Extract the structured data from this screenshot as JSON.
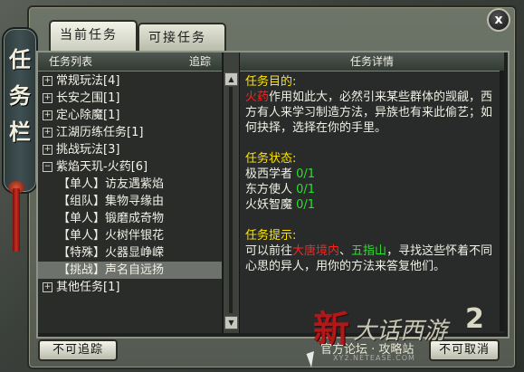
{
  "window": {
    "title_glyphs": [
      "任",
      "务",
      "栏"
    ],
    "close_label": "x"
  },
  "tabs": [
    {
      "label": "当前任务",
      "active": true
    },
    {
      "label": "可接任务",
      "active": false
    }
  ],
  "list_panel": {
    "header": "任务列表",
    "track_header": "追踪",
    "categories": [
      {
        "toggle": "+",
        "label": "常规玩法[4]"
      },
      {
        "toggle": "+",
        "label": "长安之围[1]"
      },
      {
        "toggle": "+",
        "label": "定心除魔[1]"
      },
      {
        "toggle": "+",
        "label": "江湖历练任务[1]"
      },
      {
        "toggle": "+",
        "label": "挑战玩法[3]"
      },
      {
        "toggle": "−",
        "label": "紫焰天玑-火药[6]"
      }
    ],
    "subtasks": [
      {
        "tag": "【单人】",
        "name": "访友遇紫焰",
        "selected": false
      },
      {
        "tag": "【组队】",
        "name": "集物寻缘由",
        "selected": false
      },
      {
        "tag": "【单人】",
        "name": "锻磨成奇物",
        "selected": false
      },
      {
        "tag": "【单人】",
        "name": "火树伴银花",
        "selected": false
      },
      {
        "tag": "【特殊】",
        "name": "火器显峥嵘",
        "selected": false
      },
      {
        "tag": "【挑战】",
        "name": "声名自远扬",
        "selected": true
      }
    ],
    "last_category": {
      "toggle": "+",
      "label": "其他任务[1]"
    }
  },
  "detail_panel": {
    "header": "任务详情",
    "goal_title": "任务目的:",
    "goal_highlight": "火药",
    "goal_text": "作用如此大，必然引来某些群体的觊觎，西方有人来学习制造方法，异族也有来此偷艺；如何抉择，选择在你的手里。",
    "status_title": "任务状态:",
    "status_items": [
      {
        "label": "极西学者",
        "progress": "0/1"
      },
      {
        "label": "东方使人",
        "progress": "0/1"
      },
      {
        "label": "火妖智魔",
        "progress": "0/1"
      }
    ],
    "hint_title": "任务提示:",
    "hint_pre": "可以前往",
    "hint_place1": "大唐境内",
    "hint_sep": "、",
    "hint_place2": "五指山",
    "hint_post": "，寻找这些怀着不同心思的异人，用你的方法来答复他们。"
  },
  "buttons": {
    "untrack": "不可追踪",
    "cancel": "不可取消"
  },
  "watermark": {
    "xin": "新",
    "game": "大话西游",
    "number": "2",
    "forum": "官方论坛 · 攻略站",
    "url": "XY2.NETEASE.COM"
  },
  "colors": {
    "section_title": "#ffe400",
    "highlight_green": "#2de02d",
    "highlight_red": "#ff2020"
  }
}
